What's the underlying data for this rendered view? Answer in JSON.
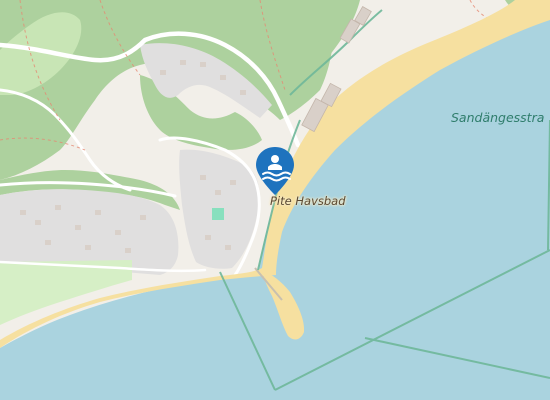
{
  "map": {
    "type": "map-tile",
    "style": "openstreetmap",
    "colors": {
      "water": "#aad3df",
      "beach": "#f6e0a0",
      "forest": "#add19e",
      "built": "#f2efe9",
      "marker": "#1e73be",
      "outline": "#6fb89a"
    }
  },
  "poi": {
    "name": "Pite Havsbad",
    "icon": "swimming-icon"
  },
  "sea_label": "Sandängesstra"
}
